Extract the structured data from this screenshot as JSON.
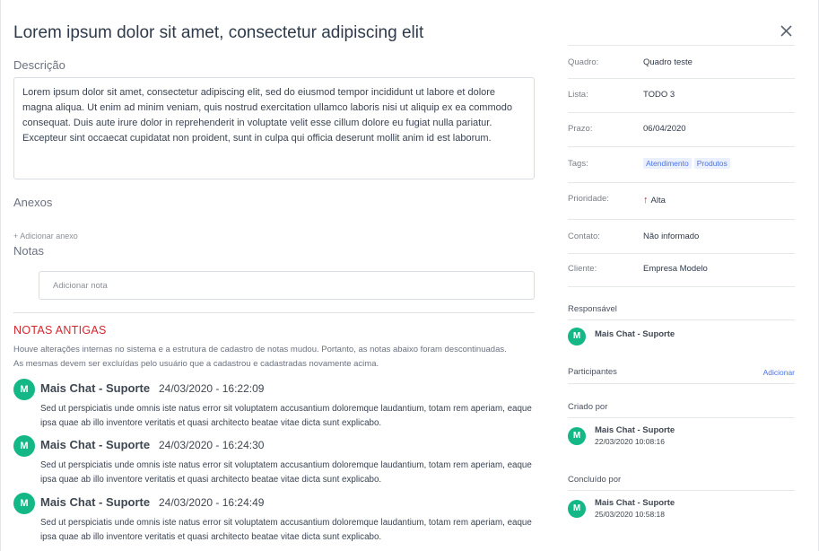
{
  "modal": {
    "title": "Lorem ipsum dolor sit amet, consectetur adipiscing elit"
  },
  "description": {
    "label": "Descrição",
    "text": "Lorem ipsum dolor sit amet, consectetur adipiscing elit, sed do eiusmod tempor incididunt ut labore et dolore magna aliqua. Ut enim ad minim veniam, quis nostrud exercitation ullamco laboris nisi ut aliquip ex ea commodo consequat. Duis aute irure dolor in reprehenderit in voluptate velit esse cillum dolore eu fugiat nulla pariatur. Excepteur sint occaecat cupidatat non proident, sunt in culpa qui officia deserunt mollit anim id est laborum."
  },
  "attachments": {
    "label": "Anexos",
    "add_label": "+ Adicionar anexo"
  },
  "notes": {
    "label": "Notas",
    "placeholder": "Adicionar nota"
  },
  "old_notes": {
    "title": "NOTAS ANTIGAS",
    "description": "Houve alterações internas no sistema e a estrutura de cadastro de notas mudou. Portanto, as notas abaixo foram descontinuadas. As mesmas devem ser excluídas pelo usuário que a cadastrou e cadastradas novamente acima.",
    "items": [
      {
        "avatar": "M",
        "author": "Mais Chat - Suporte",
        "date": "24/03/2020 - 16:22:09",
        "text": "Sed ut perspiciatis unde omnis iste natus error sit voluptatem accusantium doloremque laudantium, totam rem aperiam, eaque ipsa quae ab illo inventore veritatis et quasi architecto beatae vitae dicta sunt explicabo."
      },
      {
        "avatar": "M",
        "author": "Mais Chat - Suporte",
        "date": "24/03/2020 - 16:24:30",
        "text": "Sed ut perspiciatis unde omnis iste natus error sit voluptatem accusantium doloremque laudantium, totam rem aperiam, eaque ipsa quae ab illo inventore veritatis et quasi architecto beatae vitae dicta sunt explicabo."
      },
      {
        "avatar": "M",
        "author": "Mais Chat - Suporte",
        "date": "24/03/2020 - 16:24:49",
        "text": "Sed ut perspiciatis unde omnis iste natus error sit voluptatem accusantium doloremque laudantium, totam rem aperiam, eaque ipsa quae ab illo inventore veritatis et quasi architecto beatae vitae dicta sunt explicabo."
      }
    ]
  },
  "sidebar": {
    "fields": [
      {
        "key": "Quadro:",
        "value": "Quadro teste"
      },
      {
        "key": "Lista:",
        "value": "TODO 3"
      },
      {
        "key": "Prazo:",
        "value": "06/04/2020"
      },
      {
        "key": "Tags:",
        "value": ""
      },
      {
        "key": "Prioridade:",
        "value": "Alta"
      },
      {
        "key": "Contato:",
        "value": "Não informado"
      },
      {
        "key": "Cliente:",
        "value": "Empresa Modelo"
      }
    ],
    "tags": [
      "Atendimento",
      "Produtos"
    ],
    "priority_icon": "arrow-up-icon",
    "priority_color": "#d6262d",
    "responsible": {
      "label": "Responsável",
      "avatar": "M",
      "name": "Mais Chat - Suporte"
    },
    "participants": {
      "label": "Participantes",
      "add_label": "Adicionar"
    },
    "created_by": {
      "label": "Criado por",
      "avatar": "M",
      "name": "Mais Chat - Suporte",
      "date": "22/03/2020 10:08:16"
    },
    "completed_by": {
      "label": "Concluído por",
      "avatar": "M",
      "name": "Mais Chat - Suporte",
      "date": "25/03/2020 10:58:18"
    }
  },
  "colors": {
    "avatar": "#13b886",
    "accent_red": "#d6262d",
    "link_blue": "#4a74e8"
  }
}
